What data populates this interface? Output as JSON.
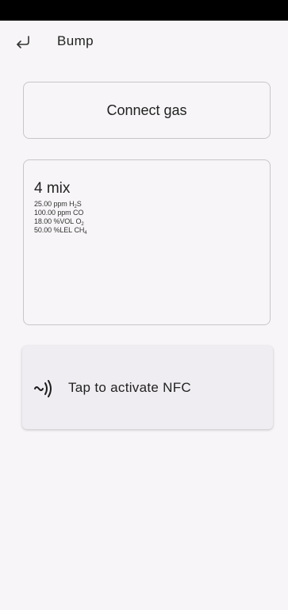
{
  "header": {
    "back_icon": "return-arrow-icon",
    "title": "Bump"
  },
  "connect": {
    "label": "Connect gas"
  },
  "mix": {
    "title": "4 mix",
    "gases": [
      {
        "value": "25.00",
        "unit": "ppm",
        "species": "H",
        "sub": "2",
        "suffix": "S"
      },
      {
        "value": "100.00",
        "unit": "ppm",
        "species": "CO",
        "sub": "",
        "suffix": ""
      },
      {
        "value": "18.00",
        "unit": "%VOL",
        "species": "O",
        "sub": "2",
        "suffix": ""
      },
      {
        "value": "50.00",
        "unit": "%LEL",
        "species": "CH",
        "sub": "4",
        "suffix": ""
      }
    ]
  },
  "nfc": {
    "icon": "nfc-icon",
    "label": "Tap to activate NFC"
  }
}
